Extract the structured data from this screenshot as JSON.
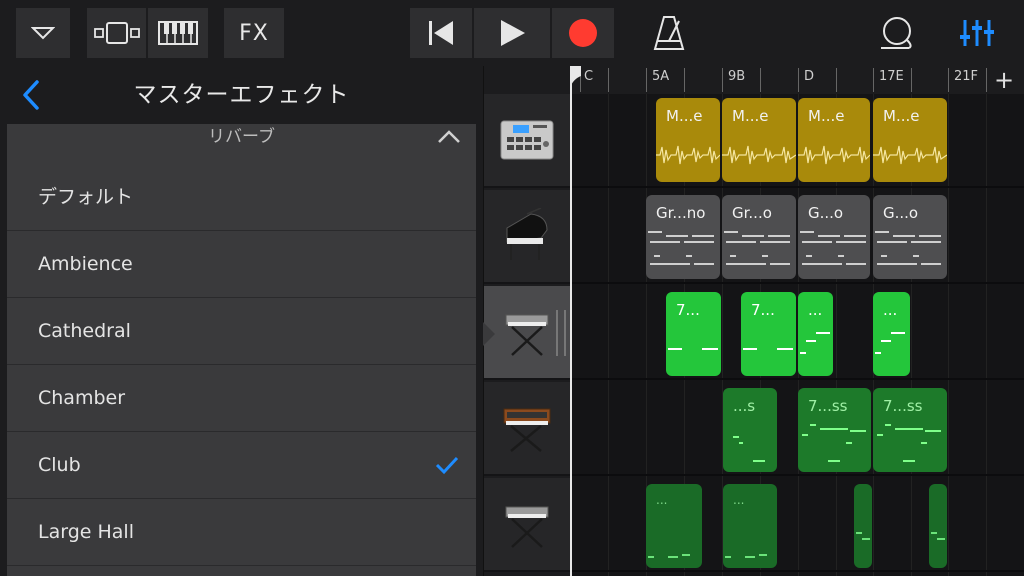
{
  "toolbar": {
    "fx_label": "FX",
    "icons": [
      "chevron-down-icon",
      "tracks-view-icon",
      "keyboard-icon",
      "fx-button",
      "rewind-icon",
      "play-icon",
      "record-icon",
      "metronome-icon",
      "loop-browser-icon",
      "mixer-icon"
    ],
    "record_color": "#ff3b30",
    "accent_color": "#1e8cff"
  },
  "panel": {
    "title": "マスターエフェクト",
    "section_title": "リバーブ",
    "items": [
      {
        "label": "デフォルト",
        "checked": false
      },
      {
        "label": "Ambience",
        "checked": false
      },
      {
        "label": "Cathedral",
        "checked": false
      },
      {
        "label": "Chamber",
        "checked": false
      },
      {
        "label": "Club",
        "checked": true
      },
      {
        "label": "Large Hall",
        "checked": false
      }
    ]
  },
  "tracks": [
    {
      "instrument": "drum-machine-icon",
      "selected": false
    },
    {
      "instrument": "grand-piano-icon",
      "selected": false
    },
    {
      "instrument": "synth-keyboard-icon",
      "selected": true
    },
    {
      "instrument": "analog-synth-icon",
      "selected": false
    },
    {
      "instrument": "synth-keyboard-icon",
      "selected": false
    }
  ],
  "ruler": {
    "labels": [
      "C",
      "5A",
      "9B",
      "D",
      "17E",
      "21F"
    ],
    "add_label": "+"
  },
  "regions": {
    "track1": [
      "M...e",
      "M...e",
      "M...e",
      "M...e"
    ],
    "track2": [
      "Gr...no",
      "Gr...o",
      "G...o",
      "G...o"
    ],
    "track3": [
      "7...",
      "7...",
      "...",
      "..."
    ],
    "track4": [
      "...s",
      "7...ss",
      "7...ss"
    ],
    "track5": [
      "...",
      "...",
      "",
      ""
    ]
  }
}
